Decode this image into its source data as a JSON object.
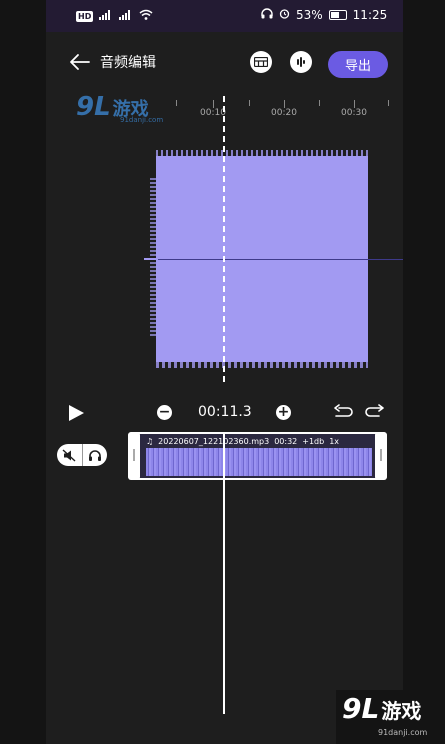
{
  "status_bar": {
    "network_badge": "HD",
    "signal_1": "⁴ᴳ",
    "signal_2": "⁴ᴳ",
    "battery_percent": "53%",
    "time": "11:25"
  },
  "header": {
    "title": "音频编辑",
    "export_label": "导出"
  },
  "ruler": {
    "labels": [
      "00:10",
      "00:20",
      "00:30"
    ]
  },
  "watermark_top": {
    "logo": "9L",
    "name": "游戏",
    "url": "91danji.com"
  },
  "controls": {
    "minus_label": "−",
    "plus_label": "+",
    "current_time": "00:11.3"
  },
  "clip": {
    "filename": "20220607_122102360.mp3",
    "duration": "00:32",
    "volume": "+1db",
    "speed": "1x"
  },
  "watermark_bottom": {
    "logo": "9L",
    "name": "游戏",
    "url": "91danji.com"
  },
  "colors": {
    "accent": "#6b5be3",
    "waveform": "#a29af2",
    "status_bar_bg": "#231b33",
    "background": "#1e1e1e"
  },
  "icons": {
    "back": "arrow-left-icon",
    "toolbar_1": "grid-icon",
    "toolbar_2": "sound-bars-icon",
    "play": "play-icon",
    "undo": "undo-icon",
    "redo": "redo-icon",
    "mute": "mute-icon",
    "headphones": "headphones-icon"
  }
}
